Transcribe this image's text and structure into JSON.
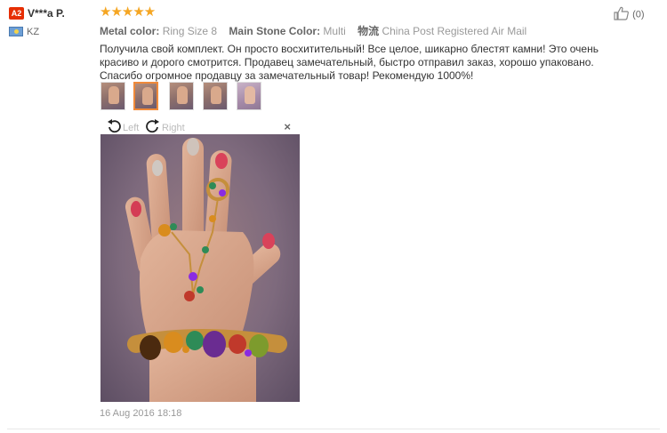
{
  "buyer": {
    "level": "A2",
    "name": "V***a P.",
    "country": "KZ"
  },
  "review": {
    "rating": 5,
    "stars": "★★★★★",
    "attrs": [
      {
        "key": "Metal color:",
        "value": "Ring Size 8"
      },
      {
        "key": "Main Stone Color:",
        "value": "Multi"
      },
      {
        "key": "物流",
        "value": "China Post Registered Air Mail"
      }
    ],
    "text": "Получила свой комплект. Он просто восхитительный! Все целое, шикарно блестят камни! Это очень красиво и дорого смотрится. Продавец замечательный, быстро отправил заказ, хорошо упаковано. Спасибо огромное продавцу за замечательный товар! Рекомендую 1000%!",
    "date": "16 Aug 2016 18:18"
  },
  "helpful": {
    "count": "(0)",
    "icon": "thumbs-up-icon"
  },
  "viewer": {
    "rotate_left": "Left",
    "rotate_right": "Right",
    "close": "×",
    "thumbnail_count": 5,
    "active_thumbnail": 2
  },
  "colors": {
    "badge": "#e62e04",
    "stars": "#f5a623",
    "active_thumb_border": "#f08a3a"
  }
}
